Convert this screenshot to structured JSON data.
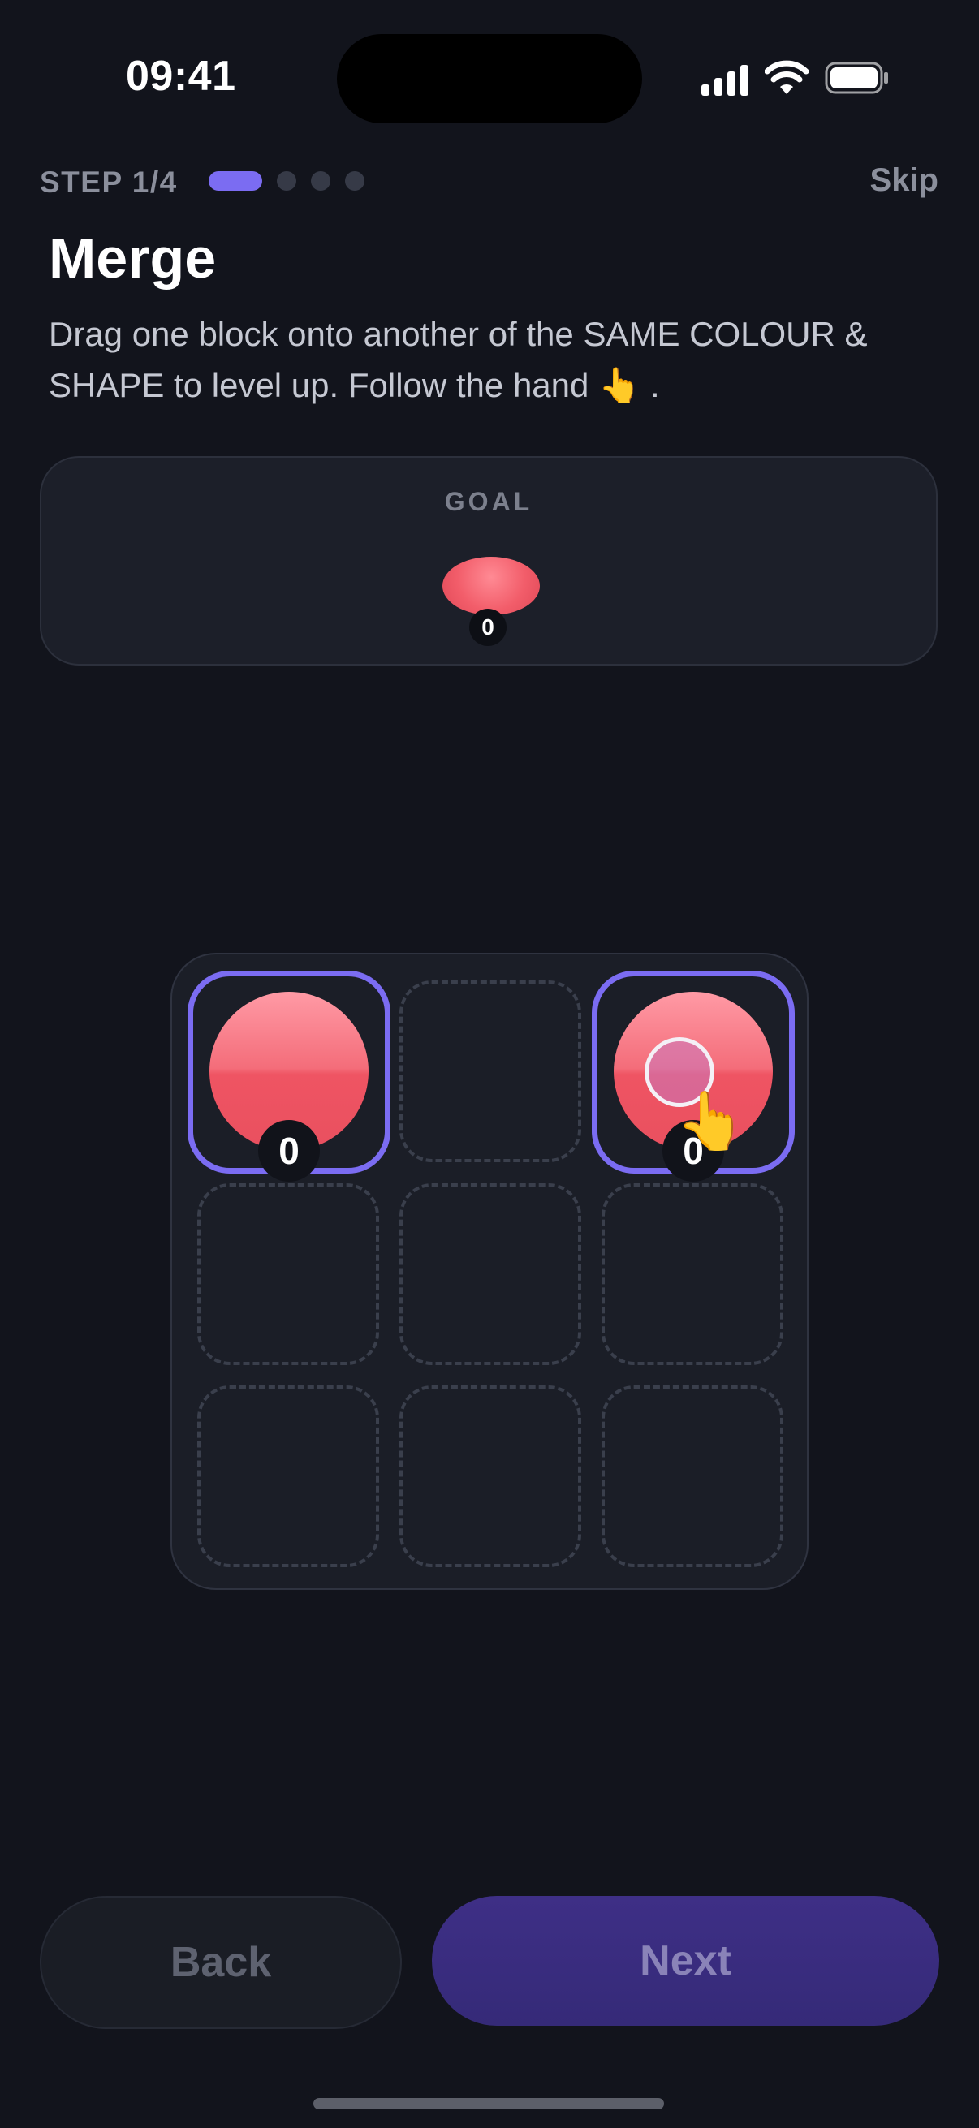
{
  "status_bar": {
    "time": "09:41",
    "icons": [
      "cellular-signal-icon",
      "wifi-icon",
      "battery-icon"
    ]
  },
  "header": {
    "step_label": "STEP 1/4",
    "progress": {
      "current": 1,
      "total": 4
    },
    "skip_label": "Skip",
    "title": "Merge",
    "description": "Drag one block onto another of the SAME COLOUR & SHAPE to level up. Follow the hand 👆 ."
  },
  "goal": {
    "label": "GOAL",
    "block": {
      "shape": "oval",
      "color": "#f25d6a",
      "level": "0"
    }
  },
  "board": {
    "rows": 3,
    "cols": 3,
    "cells": [
      {
        "block": true,
        "color": "#f25d6a",
        "level": "0",
        "highlighted": true
      },
      {
        "block": false
      },
      {
        "block": true,
        "color": "#f25d6a",
        "level": "0",
        "highlighted": true,
        "hint": "hand-pointer-icon"
      },
      {
        "block": false
      },
      {
        "block": false
      },
      {
        "block": false
      },
      {
        "block": false
      },
      {
        "block": false
      },
      {
        "block": false
      }
    ],
    "hand_icon": "👆"
  },
  "footer": {
    "back_label": "Back",
    "next_label": "Next"
  },
  "colors": {
    "background": "#12141c",
    "accent": "#7b6cf2",
    "block_red": "#f25d6a",
    "next_button": "#3a2d80"
  }
}
